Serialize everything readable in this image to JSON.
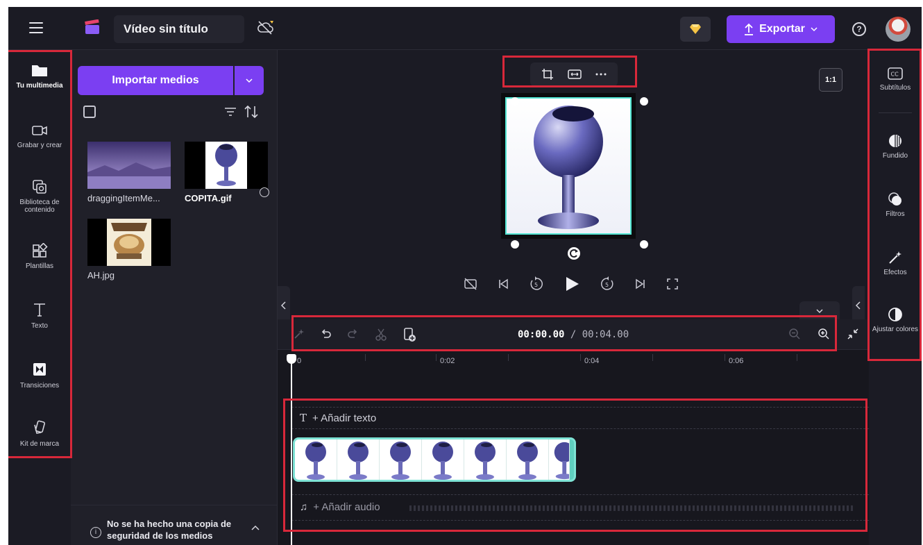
{
  "topbar": {
    "project_title": "Vídeo sin título",
    "export_label": "Exportar",
    "help_label": "?"
  },
  "left_rail": {
    "items": [
      {
        "label": "Tu multimedia",
        "icon": "folder-icon"
      },
      {
        "label": "Grabar y crear",
        "icon": "camera-icon"
      },
      {
        "label": "Biblioteca de contenido",
        "icon": "library-icon"
      },
      {
        "label": "Plantillas",
        "icon": "templates-icon"
      },
      {
        "label": "Texto",
        "icon": "text-icon"
      },
      {
        "label": "Transiciones",
        "icon": "transitions-icon"
      },
      {
        "label": "Kit de marca",
        "icon": "brand-kit-icon"
      }
    ]
  },
  "media_panel": {
    "import_label": "Importar medios",
    "items": [
      {
        "name": "draggingItemMe...",
        "bold": false
      },
      {
        "name": "COPITA.gif",
        "bold": true
      },
      {
        "name": "AH.jpg",
        "bold": false
      }
    ],
    "backup_notice": "No se ha hecho una copia de seguridad de los medios"
  },
  "preview": {
    "aspect_ratio": "1:1"
  },
  "right_rail": {
    "items": [
      {
        "label": "Subtítulos",
        "icon": "captions-icon"
      },
      {
        "label": "Fundido",
        "icon": "fade-icon"
      },
      {
        "label": "Filtros",
        "icon": "filters-icon"
      },
      {
        "label": "Efectos",
        "icon": "effects-icon"
      },
      {
        "label": "Ajustar colores",
        "icon": "adjust-colors-icon"
      }
    ]
  },
  "timeline": {
    "current_time": "00:00.00",
    "separator": " / ",
    "total_time": "00:04.00",
    "ruler_labels": [
      "0",
      "0:02",
      "0:04",
      "0:06"
    ],
    "add_text_label": "+ Añadir texto",
    "add_audio_label": "+ Añadir audio"
  },
  "colors": {
    "accent": "#7b3ff2",
    "highlight": "#d8283a",
    "clip": "#5fcfbf",
    "background": "#1b1b24"
  }
}
